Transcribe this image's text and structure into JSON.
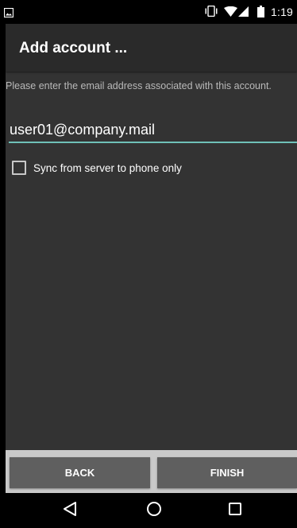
{
  "status_bar": {
    "time": "1:19",
    "icons": [
      "gallery-icon",
      "vibrate-icon",
      "wifi-icon",
      "signal-icon",
      "battery-icon"
    ]
  },
  "action_bar": {
    "title": "Add account ..."
  },
  "form": {
    "instructions": "Please enter the email address associated with this account.",
    "email_value": "user01@company.mail",
    "sync_label": "Sync from server to phone only",
    "sync_checked": false
  },
  "buttons": {
    "back_label": "BACK",
    "finish_label": "FINISH"
  },
  "nav_bar": {
    "icons": [
      "back-triangle-icon",
      "home-circle-icon",
      "recents-square-icon"
    ]
  },
  "colors": {
    "background": "#333333",
    "action_bar": "#2a2a2a",
    "accent": "#6fc1b8",
    "button": "#5f5f5f",
    "button_bar": "#c9c9c9"
  }
}
